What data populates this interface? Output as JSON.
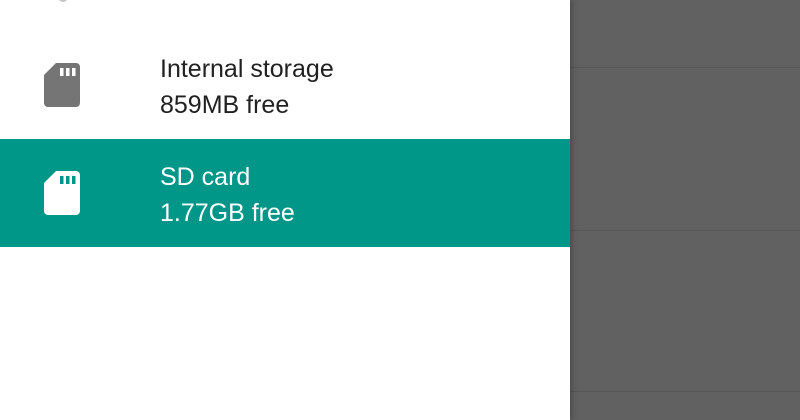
{
  "storage_list": {
    "items": [
      {
        "title": "Internal storage",
        "free": "859MB free",
        "icon": "sd-card-icon",
        "selected": false
      },
      {
        "title": "SD card",
        "free": "1.77GB free",
        "icon": "sd-card-icon",
        "selected": true
      }
    ]
  },
  "colors": {
    "accent": "#009688",
    "icon_default": "#757575",
    "icon_selected": "#ffffff",
    "text_default": "#212121",
    "scrim": "#616161"
  }
}
